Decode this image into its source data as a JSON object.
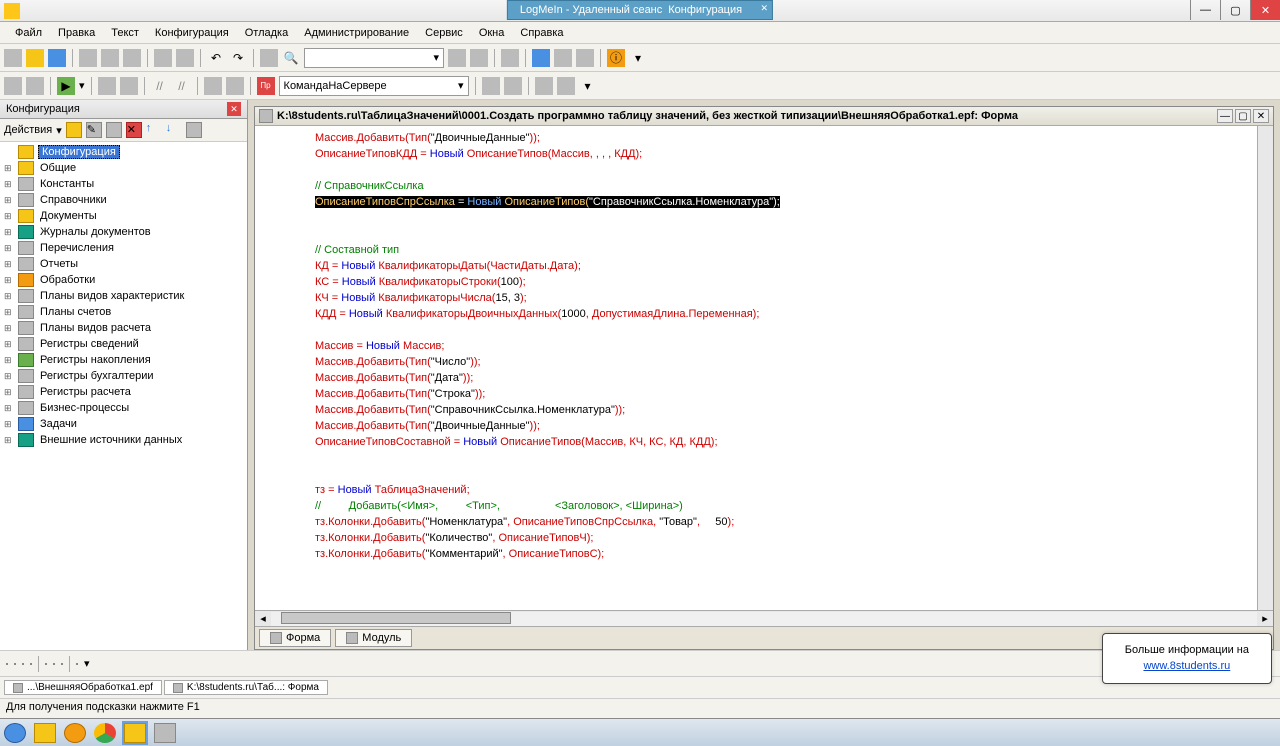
{
  "window": {
    "overlay": "LogMeIn - Удаленный сеанс",
    "title_suffix": "Конфигурация"
  },
  "menu": [
    "Файл",
    "Правка",
    "Текст",
    "Конфигурация",
    "Отладка",
    "Администрирование",
    "Сервис",
    "Окна",
    "Справка"
  ],
  "toolbar2": {
    "combo": "КомандаНаСервере"
  },
  "left_panel": {
    "title": "Конфигурация",
    "actions_label": "Действия",
    "items": [
      {
        "label": "Конфигурация",
        "sel": true,
        "icon": "ic-yellow"
      },
      {
        "label": "Общие",
        "icon": "ic-yellow"
      },
      {
        "label": "Константы",
        "icon": "ic-grey"
      },
      {
        "label": "Справочники",
        "icon": "ic-grey"
      },
      {
        "label": "Документы",
        "icon": "ic-yellow"
      },
      {
        "label": "Журналы документов",
        "icon": "ic-teal"
      },
      {
        "label": "Перечисления",
        "icon": "ic-grey"
      },
      {
        "label": "Отчеты",
        "icon": "ic-grey"
      },
      {
        "label": "Обработки",
        "icon": "ic-orange"
      },
      {
        "label": "Планы видов характеристик",
        "icon": "ic-grey"
      },
      {
        "label": "Планы счетов",
        "icon": "ic-grey"
      },
      {
        "label": "Планы видов расчета",
        "icon": "ic-grey"
      },
      {
        "label": "Регистры сведений",
        "icon": "ic-grey"
      },
      {
        "label": "Регистры накопления",
        "icon": "ic-green"
      },
      {
        "label": "Регистры бухгалтерии",
        "icon": "ic-grey"
      },
      {
        "label": "Регистры расчета",
        "icon": "ic-grey"
      },
      {
        "label": "Бизнес-процессы",
        "icon": "ic-grey"
      },
      {
        "label": "Задачи",
        "icon": "ic-blue"
      },
      {
        "label": "Внешние источники данных",
        "icon": "ic-teal"
      }
    ]
  },
  "doc": {
    "title": "K:\\8students.ru\\ТаблицаЗначений\\0001.Создать программно таблицу значений, без жесткой типизации\\ВнешняяОбработка1.epf: Форма",
    "tabs": [
      "Форма",
      "Модуль"
    ]
  },
  "code_lines": [
    {
      "t": "Массив.Добавить(Тип(\"ДвоичныеДанные\"));",
      "cls": ""
    },
    {
      "t": "ОписаниеТиповКДД = Новый ОписаниеТипов(Массив, , , , КДД);",
      "mix": [
        [
          "ОписаниеТиповКДД ",
          "kw"
        ],
        [
          "= ",
          "op"
        ],
        [
          "Новый ",
          "bl"
        ],
        [
          "ОписаниеТипов(Массив, , , , КДД);",
          "kw"
        ]
      ]
    },
    {
      "t": ""
    },
    {
      "t": "// СправочникСсылка",
      "cls": "cm"
    },
    {
      "hl": true,
      "mix": [
        [
          "ОписаниеТиповСпрСсылка ",
          "id"
        ],
        [
          "= ",
          "hl"
        ],
        [
          "Новый ",
          "kw2"
        ],
        [
          "ОписаниеТипов(",
          "id"
        ],
        [
          "\"СправочникСсылка.Номенклатура\"",
          "hl"
        ],
        [
          ");",
          "hl"
        ]
      ]
    },
    {
      "t": ""
    },
    {
      "t": ""
    },
    {
      "t": "// Составной тип",
      "cls": "cm"
    },
    {
      "mix": [
        [
          "КД ",
          "kw"
        ],
        [
          "= ",
          "op"
        ],
        [
          "Новый ",
          "bl"
        ],
        [
          "КвалификаторыДаты(ЧастиДаты.Дата);",
          "kw"
        ]
      ]
    },
    {
      "mix": [
        [
          "КС ",
          "kw"
        ],
        [
          "= ",
          "op"
        ],
        [
          "Новый ",
          "bl"
        ],
        [
          "КвалификаторыСтроки(",
          "kw"
        ],
        [
          "100",
          "fn"
        ],
        [
          ");",
          "kw"
        ]
      ]
    },
    {
      "mix": [
        [
          "КЧ ",
          "kw"
        ],
        [
          "= ",
          "op"
        ],
        [
          "Новый ",
          "bl"
        ],
        [
          "КвалификаторыЧисла(",
          "kw"
        ],
        [
          "15, 3",
          "fn"
        ],
        [
          ");",
          "kw"
        ]
      ]
    },
    {
      "mix": [
        [
          "КДД ",
          "kw"
        ],
        [
          "= ",
          "op"
        ],
        [
          "Новый ",
          "bl"
        ],
        [
          "КвалификаторыДвоичныхДанных(",
          "kw"
        ],
        [
          "1000",
          "fn"
        ],
        [
          ", ДопустимаяДлина.Переменная);",
          "kw"
        ]
      ]
    },
    {
      "t": ""
    },
    {
      "mix": [
        [
          "Массив ",
          "kw"
        ],
        [
          "= ",
          "op"
        ],
        [
          "Новый ",
          "bl"
        ],
        [
          "Массив;",
          "kw"
        ]
      ]
    },
    {
      "t": "Массив.Добавить(Тип(\"Число\"));"
    },
    {
      "t": "Массив.Добавить(Тип(\"Дата\"));"
    },
    {
      "t": "Массив.Добавить(Тип(\"Строка\"));"
    },
    {
      "t": "Массив.Добавить(Тип(\"СправочникСсылка.Номенклатура\"));"
    },
    {
      "t": "Массив.Добавить(Тип(\"ДвоичныеДанные\"));"
    },
    {
      "mix": [
        [
          "ОписаниеТиповСоставной ",
          "kw"
        ],
        [
          "= ",
          "op"
        ],
        [
          "Новый ",
          "bl"
        ],
        [
          "ОписаниеТипов(Массив, КЧ, КС, КД, КДД);",
          "kw"
        ]
      ]
    },
    {
      "t": ""
    },
    {
      "t": ""
    },
    {
      "mix": [
        [
          "тз ",
          "kw"
        ],
        [
          "= ",
          "op"
        ],
        [
          "Новый ",
          "bl"
        ],
        [
          "ТаблицаЗначений;",
          "kw"
        ]
      ]
    },
    {
      "t": "//         Добавить(<Имя>,         <Тип>,                  <Заголовок>, <Ширина>)",
      "cls": "cm"
    },
    {
      "mix": [
        [
          "тз.Колонки.Добавить(",
          "kw"
        ],
        [
          "\"Номенклатура\"",
          "fn"
        ],
        [
          ", ОписаниеТиповСпрСсылка, ",
          "kw"
        ],
        [
          "\"Товар\"",
          "fn"
        ],
        [
          ",     ",
          "kw"
        ],
        [
          "50",
          "fn"
        ],
        [
          ");",
          "kw"
        ]
      ]
    },
    {
      "mix": [
        [
          "тз.Колонки.Добавить(",
          "kw"
        ],
        [
          "\"Количество\"",
          "fn"
        ],
        [
          ", ОписаниеТиповЧ);",
          "kw"
        ]
      ]
    },
    {
      "mix": [
        [
          "тз.Колонки.Добавить(",
          "kw"
        ],
        [
          "\"Комментарий\"",
          "fn"
        ],
        [
          ", ОписаниеТиповС);",
          "kw"
        ]
      ]
    }
  ],
  "file_tabs": [
    "...\\ВнешняяОбработка1.epf",
    "K:\\8students.ru\\Таб...: Форма"
  ],
  "status": "Для получения подсказки нажмите F1",
  "infobox": {
    "line1": "Больше информации на",
    "link": "www.8students.ru"
  }
}
